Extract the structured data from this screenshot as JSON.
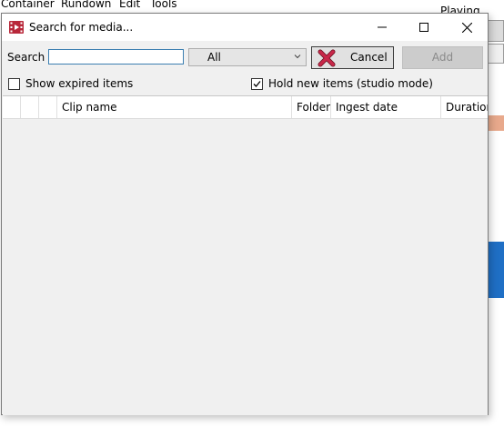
{
  "background_app": {
    "menu": [
      "Container",
      "Rundown",
      "Edit",
      "Tools"
    ],
    "status": "Playing"
  },
  "dialog": {
    "title": "Search for media...",
    "search_label": "Search",
    "search_value": "",
    "filter_selected": "All",
    "cancel_label": "Cancel",
    "add_label": "Add",
    "show_expired_label": "Show expired items",
    "show_expired_checked": false,
    "hold_new_label": "Hold new items (studio mode)",
    "hold_new_checked": true
  },
  "grid": {
    "columns": [
      "",
      "",
      "",
      "Clip name",
      "Folder",
      "Ingest date",
      "Duration"
    ],
    "rows": []
  },
  "colors": {
    "dialog_bg": "#f0f0f0",
    "cancel_icon": "#c8284a",
    "focus_border": "#3c7fb1"
  }
}
